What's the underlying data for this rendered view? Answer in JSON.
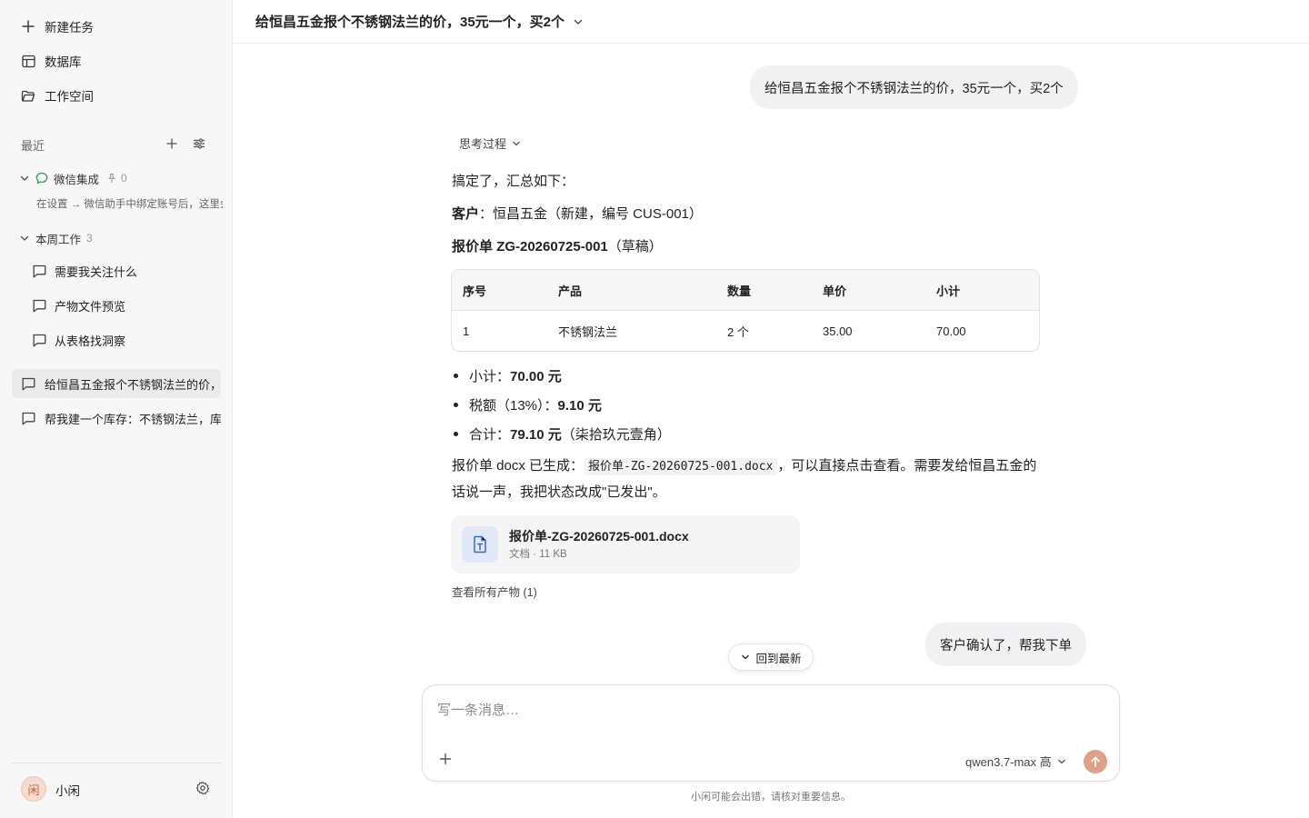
{
  "sidebar": {
    "nav": [
      {
        "label": "新建任务",
        "icon": "plus-icon"
      },
      {
        "label": "数据库",
        "icon": "table-icon"
      },
      {
        "label": "工作空间",
        "icon": "folder-icon"
      }
    ],
    "recent_label": "最近",
    "wechat_group": {
      "title": "微信集成",
      "pin_count": "0",
      "hint": "在设置 → 微信助手中绑定账号后，这里会"
    },
    "week_group": {
      "title": "本周工作",
      "count": "3",
      "items": [
        "需要我关注什么",
        "产物文件预览",
        "从表格找洞察"
      ]
    },
    "chats": [
      {
        "label": "给恒昌五金报个不锈钢法兰的价，",
        "active": true
      },
      {
        "label": "帮我建一个库存：不锈钢法兰，库",
        "active": false
      }
    ],
    "user": {
      "avatar_char": "闲",
      "name": "小闲"
    }
  },
  "header": {
    "title": "给恒昌五金报个不锈钢法兰的价，35元一个，买2个"
  },
  "messages": {
    "user_1": "给恒昌五金报个不锈钢法兰的价，35元一个，买2个",
    "thinking_label": "思考过程",
    "intro": "搞定了，汇总如下：",
    "customer_label": "客户",
    "customer_value": "：恒昌五金（新建，编号 CUS-001）",
    "quote_label": "报价单 ZG-20260725-001",
    "quote_status": "（草稿）",
    "table": {
      "headers": [
        "序号",
        "产品",
        "数量",
        "单价",
        "小计"
      ],
      "rows": [
        [
          "1",
          "不锈钢法兰",
          "2 个",
          "35.00",
          "70.00"
        ]
      ]
    },
    "bullets": [
      {
        "label": "小计：",
        "value": "70.00 元",
        "suffix": ""
      },
      {
        "label": "税额（13%）：",
        "value": "9.10 元",
        "suffix": ""
      },
      {
        "label": "合计：",
        "value": "79.10 元",
        "suffix": "（柒拾玖元壹角）"
      }
    ],
    "para_before": "报价单 docx 已生成：",
    "para_code": "报价单-ZG-20260725-001.docx",
    "para_after": "，可以直接点击查看。需要发给恒昌五金的话说一声，我把状态改成\"已发出\"。",
    "file": {
      "name": "报价单-ZG-20260725-001.docx",
      "meta": "文档 · 11 KB"
    },
    "view_all": "查看所有产物 (1)",
    "user_2": "客户确认了，帮我下单"
  },
  "scroll_label": "回到最新",
  "composer": {
    "placeholder": "写一条消息…",
    "model": "qwen3.7-max 高"
  },
  "disclaimer": "小闲可能会出错，请核对重要信息。",
  "colors": {
    "send_button": "#dfa088",
    "wechat_green": "#2aa05a",
    "file_icon_blue": "#3c68c8"
  }
}
